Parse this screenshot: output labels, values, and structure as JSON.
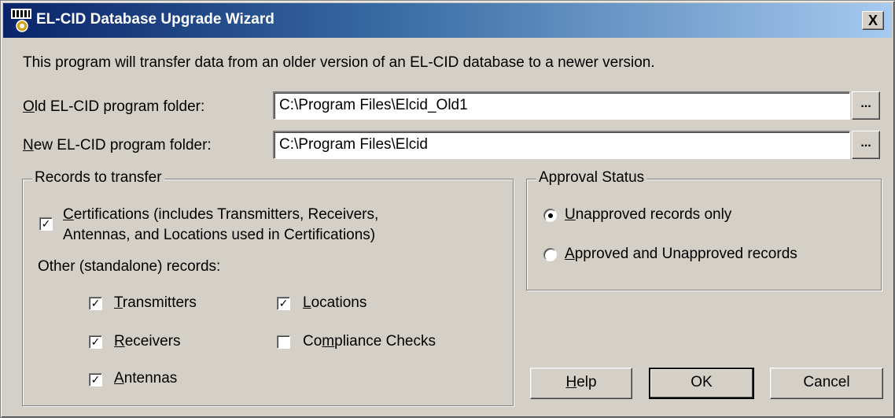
{
  "window": {
    "title": "EL-CID Database Upgrade Wizard",
    "close_label": "X"
  },
  "intro_text": "This program will transfer data from an older version of an EL-CID database to a newer version.",
  "old_folder": {
    "label_prefix": "O",
    "label_rest": "ld EL-CID program folder:",
    "value": "C:\\Program Files\\Elcid_Old1",
    "browse_label": "..."
  },
  "new_folder": {
    "label_prefix": "N",
    "label_rest": "ew EL-CID program folder:",
    "value": "C:\\Program Files\\Elcid",
    "browse_label": "..."
  },
  "records_group": {
    "title": "Records to transfer",
    "certifications": {
      "checked": true,
      "label_prefix": "C",
      "line1_rest": "ertifications (includes Transmitters, Receivers,",
      "line2": "Antennas, and Locations used in Certifications)"
    },
    "other_label": "Other (standalone) records:",
    "items": [
      {
        "prefix": "T",
        "rest": "ransmitters",
        "checked": true
      },
      {
        "prefix": "R",
        "rest": "eceivers",
        "checked": true
      },
      {
        "prefix": "A",
        "rest": "ntennas",
        "checked": true
      },
      {
        "prefix": "L",
        "rest": "ocations",
        "checked": true
      },
      {
        "before": "Co",
        "prefix": "m",
        "rest": "pliance Checks",
        "checked": false
      }
    ]
  },
  "approval_group": {
    "title": "Approval Status",
    "options": [
      {
        "prefix": "U",
        "rest": "napproved records only",
        "selected": true
      },
      {
        "prefix": "A",
        "rest": "pproved and Unapproved records",
        "selected": false
      }
    ]
  },
  "buttons": {
    "help_prefix": "H",
    "help_rest": "elp",
    "ok": "OK",
    "cancel": "Cancel"
  },
  "check_mark": "✓"
}
